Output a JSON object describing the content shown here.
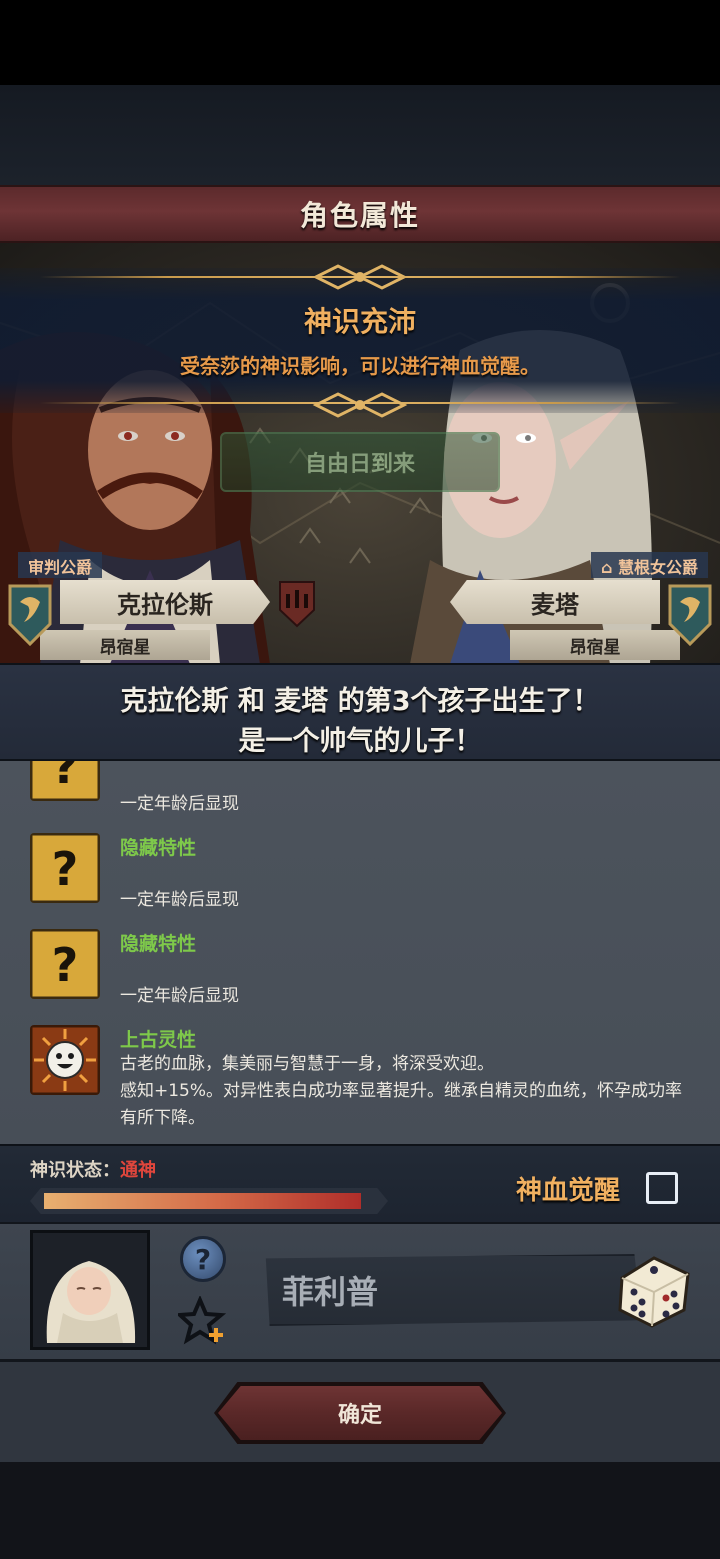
{
  "header": {
    "title": "角色属性"
  },
  "banner": {
    "title": "神识充沛",
    "subtitle": "受奈莎的神识影响，可以进行神血觉醒。"
  },
  "event_button": {
    "label": "自由日到来"
  },
  "parents": {
    "left": {
      "rank": "审判公爵",
      "name": "克拉伦斯",
      "star": "昂宿星"
    },
    "right": {
      "rank": "慧根女公爵",
      "name": "麦塔",
      "star": "昂宿星"
    }
  },
  "announcement": {
    "line1": "克拉伦斯 和 麦塔 的第3个孩子出生了！",
    "line2": "是一个帅气的儿子！"
  },
  "traits": [
    {
      "name": "",
      "desc": "一定年龄后显现",
      "icon": "question-mark-icon"
    },
    {
      "name": "隐藏特性",
      "desc": "一定年龄后显现",
      "icon": "question-mark-icon"
    },
    {
      "name": "隐藏特性",
      "desc": "一定年龄后显现",
      "icon": "question-mark-icon"
    },
    {
      "name": "上古灵性",
      "desc": "古老的血脉，集美丽与智慧于一身，将深受欢迎。\n感知+15%。对异性表白成功率显著提升。继承自精灵的血统，怀孕成功率有所下降。",
      "icon": "smiling-sun-icon"
    }
  ],
  "status": {
    "label": "神识状态：",
    "value": "通神",
    "level": 0.96,
    "awaken_label": "神血觉醒",
    "awaken_checked": false
  },
  "child": {
    "name": "菲利普",
    "help_symbol": "?"
  },
  "confirm": {
    "label": "确定"
  },
  "colors": {
    "accent_gold": "#f0b060",
    "trait_green": "#7ec94a",
    "status_red": "#e0463c"
  }
}
